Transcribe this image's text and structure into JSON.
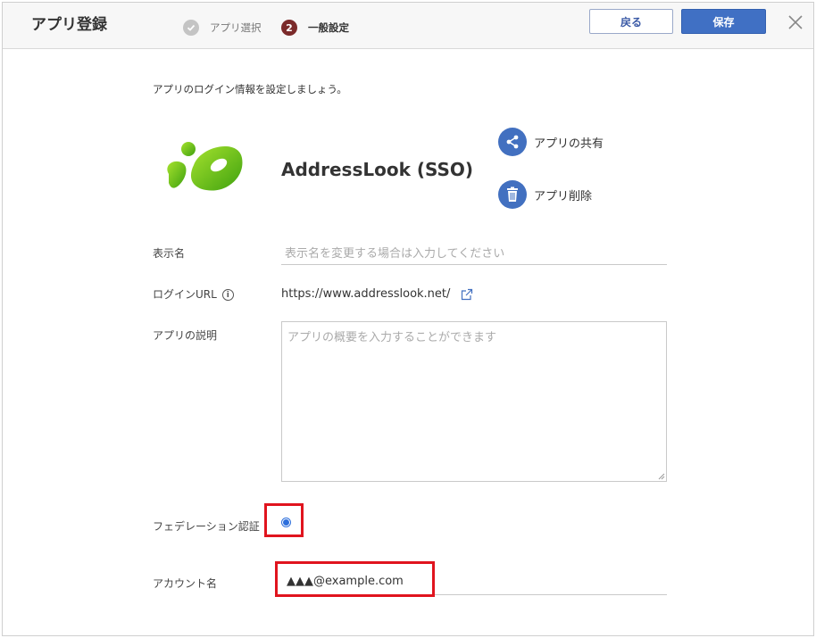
{
  "header": {
    "title": "アプリ登録",
    "steps": [
      {
        "label": "アプリ選択",
        "marker": "check-icon",
        "state": "completed"
      },
      {
        "label": "一般設定",
        "marker": "2",
        "state": "current"
      }
    ],
    "back_label": "戻る",
    "save_label": "保存"
  },
  "intro": "アプリのログイン情報を設定しましょう。",
  "app": {
    "name": "AddressLook (SSO)",
    "logo_icon": "addresslook-logo",
    "actions": {
      "share_label": "アプリの共有",
      "delete_label": "アプリ削除"
    }
  },
  "form": {
    "display_name": {
      "label": "表示名",
      "placeholder": "表示名を変更する場合は入力してください",
      "value": ""
    },
    "login_url": {
      "label": "ログインURL",
      "value": "https://www.addresslook.net/"
    },
    "description": {
      "label": "アプリの説明",
      "placeholder": "アプリの概要を入力することができます",
      "value": ""
    },
    "federation": {
      "label": "フェデレーション認証",
      "checked": true
    },
    "account": {
      "label": "アカウント名",
      "value": "▲▲▲@example.com"
    }
  },
  "colors": {
    "primary": "#4070c4",
    "highlight": "#e0141e",
    "step_active": "#7b2a2a",
    "logo_green": "#6cc01e"
  }
}
